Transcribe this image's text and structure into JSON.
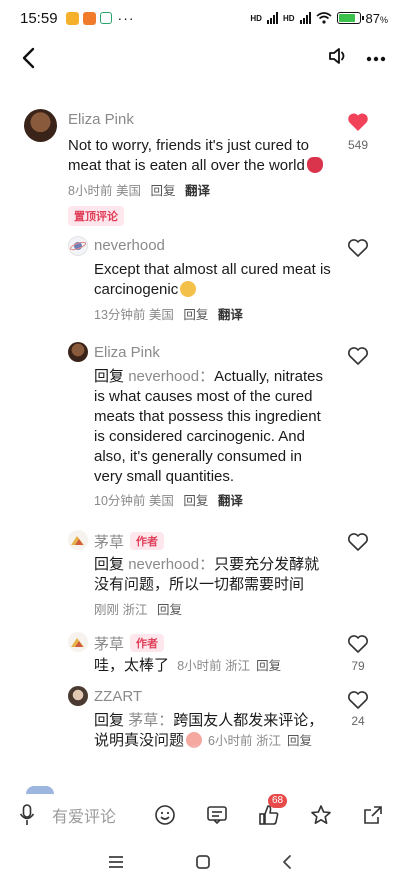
{
  "status": {
    "time": "15:59",
    "dots": "···",
    "net1": "HD",
    "net2": "HD",
    "battery": "87",
    "battery_unit": "%"
  },
  "colors": {
    "accent_red": "#f24259",
    "badge_red": "#e84a4a",
    "muted": "#8a8a8a"
  },
  "comments": [
    {
      "user": "Eliza Pink",
      "text": "Not to worry, friends it's just cured to meat that is eaten all over the world",
      "time": "8小时前",
      "location": "美国",
      "reply": "回复",
      "translate": "翻译",
      "pin": "置顶评论",
      "likes": "549",
      "liked": true
    },
    {
      "user": "neverhood",
      "text": "Except that almost all cured meat is carcinogenic",
      "time": "13分钟前",
      "location": "美国",
      "reply": "回复",
      "translate": "翻译"
    },
    {
      "user": "Eliza Pink",
      "reply_prefix": "回复",
      "reply_target": "neverhood：",
      "text": "Actually, nitrates is what causes most of the cured meats that possess this ingredient is considered carcinogenic. And also, it's generally consumed in very small quantities.",
      "time": "10分钟前",
      "location": "美国",
      "reply": "回复",
      "translate": "翻译"
    },
    {
      "user": "茅草",
      "author": "作者",
      "reply_prefix": "回复",
      "reply_target": "neverhood：",
      "text": "只要充分发酵就没有问题，所以一切都需要时间",
      "time": "刚刚",
      "location": "浙江",
      "reply": "回复"
    },
    {
      "user": "茅草",
      "author": "作者",
      "text": "哇，太棒了",
      "time": "8小时前",
      "location": "浙江",
      "reply": "回复",
      "likes": "79"
    },
    {
      "user": "ZZART",
      "reply_prefix": "回复",
      "reply_target": "茅草：",
      "text": "跨国友人都发来评论，说明真没问题",
      "time": "6小时前",
      "location": "浙江",
      "reply": "回复",
      "likes": "24"
    }
  ],
  "composer": {
    "placeholder": "有爱评论",
    "like_badge": "68"
  }
}
